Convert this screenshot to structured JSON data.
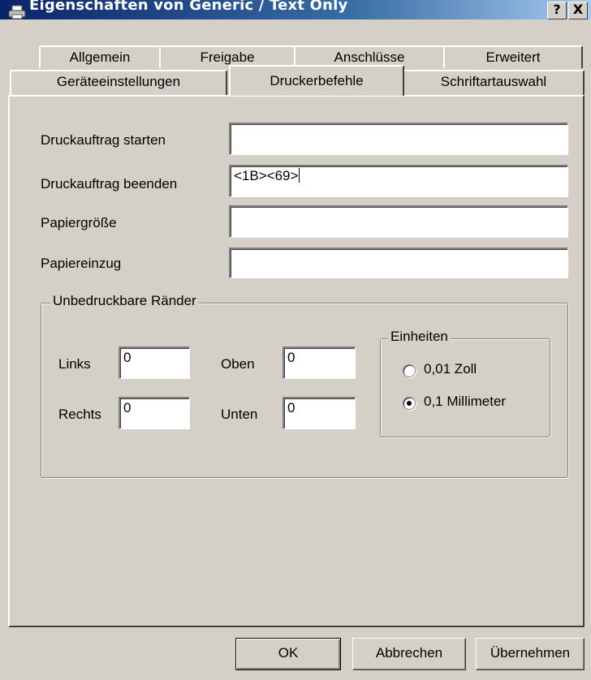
{
  "window": {
    "title": "Eigenschaften von Generic / Text Only",
    "help_label": "?",
    "close_label": "X"
  },
  "tabs": {
    "row1": [
      "Allgemein",
      "Freigabe",
      "Anschlüsse",
      "Erweitert"
    ],
    "row2": [
      "Geräteeinstellungen",
      "Druckerbefehle",
      "Schriftartauswahl"
    ],
    "active": "Druckerbefehle"
  },
  "commands": {
    "start_label": "Druckauftrag starten",
    "start_value": "",
    "end_label": "Druckauftrag beenden",
    "end_value": "<1B><69>",
    "paper_size_label": "Papiergröße",
    "paper_size_value": "",
    "paper_feed_label": "Papiereinzug",
    "paper_feed_value": ""
  },
  "margins": {
    "group_title": "Unbedruckbare Ränder",
    "left_label": "Links",
    "left_value": "0",
    "top_label": "Oben",
    "top_value": "0",
    "right_label": "Rechts",
    "right_value": "0",
    "bottom_label": "Unten",
    "bottom_value": "0"
  },
  "units": {
    "group_title": "Einheiten",
    "options": [
      "0,01 Zoll",
      "0,1 Millimeter"
    ],
    "selected": "0,1 Millimeter"
  },
  "buttons": {
    "ok": "OK",
    "cancel": "Abbrechen",
    "apply": "Übernehmen"
  },
  "colors": {
    "window_face": "#d4d0c8",
    "titlebar_start": "#0a246a",
    "titlebar_end": "#a6caf0"
  }
}
